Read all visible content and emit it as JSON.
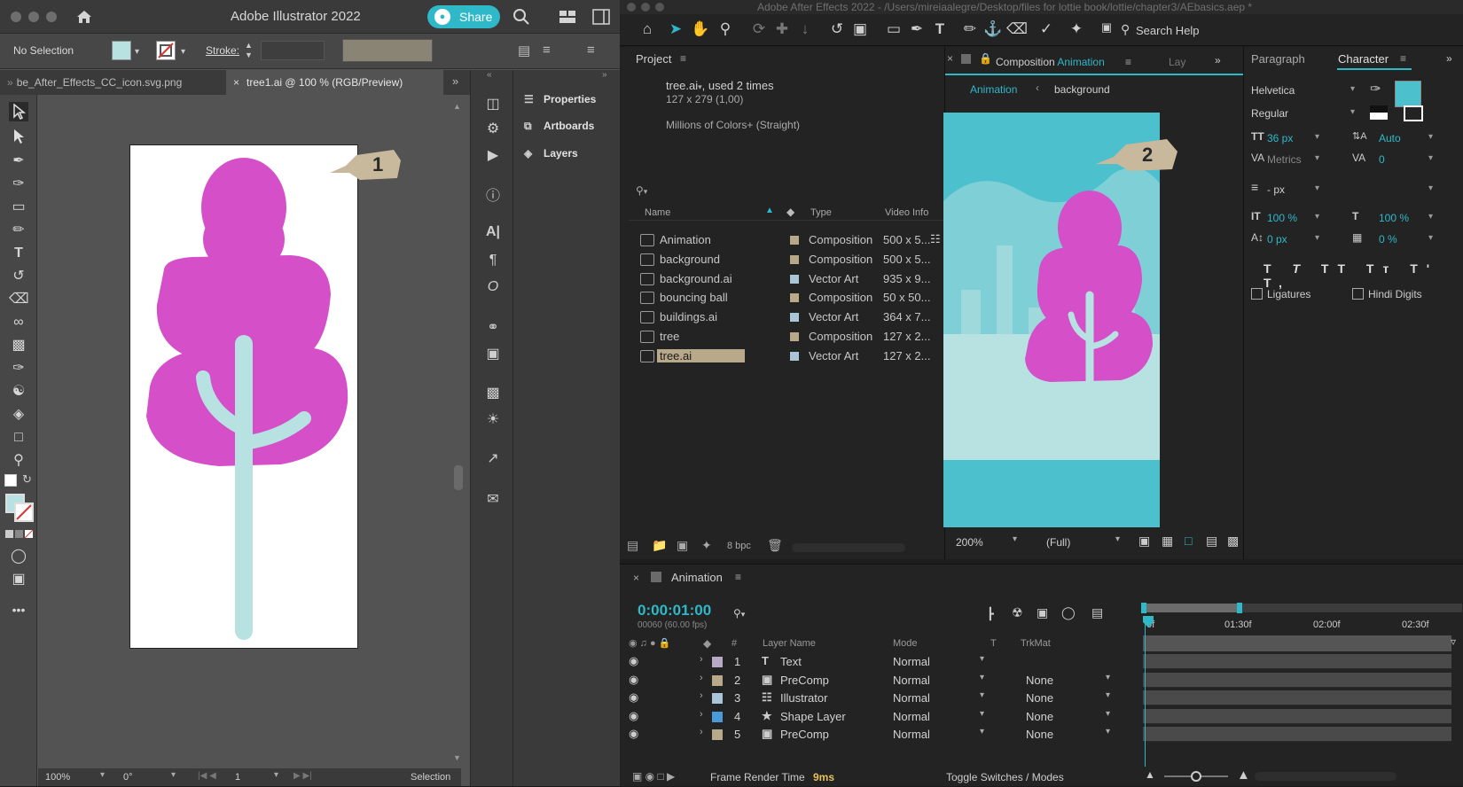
{
  "illustrator": {
    "window_title": "Adobe Illustrator 2022",
    "share_label": "Share",
    "selection_status": "No Selection",
    "stroke_label": "Stroke:",
    "tabs": [
      {
        "label": "be_After_Effects_CC_icon.svg.png"
      },
      {
        "label": "tree1.ai @ 100 % (RGB/Preview)"
      }
    ],
    "panels": [
      {
        "label": "Properties"
      },
      {
        "label": "Artboards"
      },
      {
        "label": "Layers"
      }
    ],
    "callout_number": "1",
    "status": {
      "zoom": "100%",
      "rotation": "0°",
      "artboard": "1",
      "tool": "Selection"
    },
    "colors": {
      "tree_pink": "#d44fc8",
      "trunk_blue": "#b8e2e2",
      "callout": "#c8b99c"
    }
  },
  "aftereffects": {
    "window_title": "Adobe After Effects 2022 - /Users/mireiaalegre/Desktop/files for lottie book/lottie/chapter3/AEbasics.aep *",
    "search_help": "Search Help",
    "project_tab": "Project",
    "project_info": {
      "name": "tree.ai",
      "used": ", used 2 times",
      "dims": "127 x 279 (1,00)",
      "colors": "Millions of Colors+ (Straight)"
    },
    "project_columns": {
      "name": "Name",
      "type": "Type",
      "video": "Video Info"
    },
    "project_items": [
      {
        "name": "Animation",
        "type": "Composition",
        "video": "500 x 5...",
        "swatch": "#b8a98a"
      },
      {
        "name": "background",
        "type": "Composition",
        "video": "500 x 5...",
        "swatch": "#b8a98a"
      },
      {
        "name": "background.ai",
        "type": "Vector Art",
        "video": "935 x 9...",
        "swatch": "#a9c6d8"
      },
      {
        "name": "bouncing ball",
        "type": "Composition",
        "video": "50 x 50...",
        "swatch": "#b8a98a"
      },
      {
        "name": "buildings.ai",
        "type": "Vector Art",
        "video": "364 x 7...",
        "swatch": "#a9c6d8"
      },
      {
        "name": "tree",
        "type": "Composition",
        "video": "127 x 2...",
        "swatch": "#b8a98a"
      },
      {
        "name": "tree.ai",
        "type": "Vector Art",
        "video": "127 x 2...",
        "swatch": "#a9c6d8"
      }
    ],
    "project_footer": {
      "bpc": "8 bpc"
    },
    "comp_panel": {
      "tab_prefix": "Composition",
      "tab_name": "Animation",
      "other_tab": "Lay",
      "breadcrumb_1": "Animation",
      "breadcrumb_2": "background",
      "zoom": "200%",
      "resolution": "(Full)",
      "callout_number": "2"
    },
    "character_panel": {
      "tab_paragraph": "Paragraph",
      "tab_character": "Character",
      "font": "Helvetica",
      "style": "Regular",
      "size": "36 px",
      "leading": "Auto",
      "kerning": "Metrics",
      "tracking": "0",
      "stroke_width": "- px",
      "vscale": "100 %",
      "hscale": "100 %",
      "baseline": "0 px",
      "tsume": "0 %",
      "ligatures": "Ligatures",
      "hindi_digits": "Hindi Digits"
    },
    "timeline": {
      "comp_name": "Animation",
      "timecode": "0:00:01:00",
      "frames": "00060 (60.00 fps)",
      "ruler": [
        "0f",
        "01:30f",
        "02:00f",
        "02:30f"
      ],
      "columns": {
        "num": "#",
        "layer_name": "Layer Name",
        "mode": "Mode",
        "t": "T",
        "trkmat": "TrkMat"
      },
      "layers": [
        {
          "num": "1",
          "name": "Text",
          "icon": "T",
          "mode": "Normal",
          "trkmat": "",
          "swatch": "#b8a9c6"
        },
        {
          "num": "2",
          "name": "PreComp",
          "icon": "comp",
          "mode": "Normal",
          "trkmat": "None",
          "swatch": "#b8a98a"
        },
        {
          "num": "3",
          "name": "Illustrator",
          "icon": "file",
          "mode": "Normal",
          "trkmat": "None",
          "swatch": "#a9c6d8"
        },
        {
          "num": "4",
          "name": "Shape Layer",
          "icon": "star",
          "mode": "Normal",
          "trkmat": "None",
          "swatch": "#4a9ad8"
        },
        {
          "num": "5",
          "name": "PreComp",
          "icon": "comp",
          "mode": "Normal",
          "trkmat": "None",
          "swatch": "#b8a98a"
        }
      ],
      "footer_label": "Frame Render Time",
      "footer_value": "9ms",
      "toggle": "Toggle Switches / Modes"
    },
    "colors": {
      "accent": "#2fb8c8",
      "comp_bg": "#4cc0cc",
      "tree_pink": "#d44fc8"
    }
  }
}
